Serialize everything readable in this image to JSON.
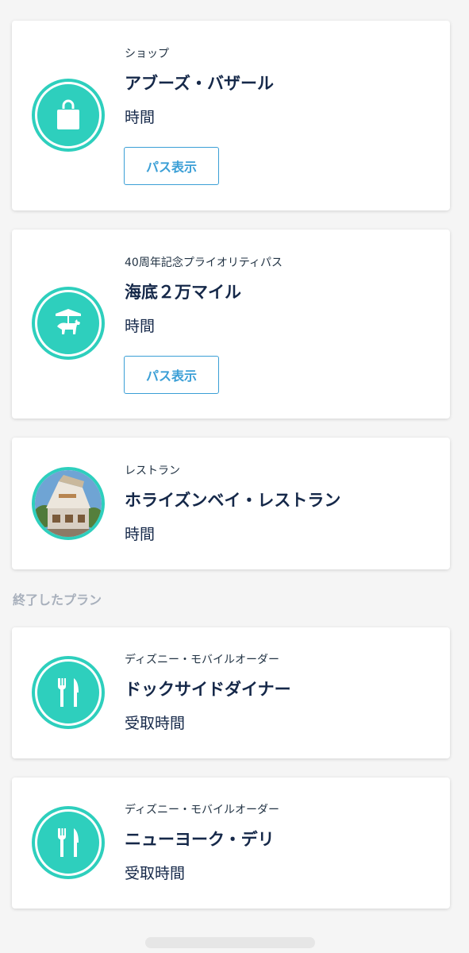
{
  "plans": [
    {
      "category": "ショップ",
      "name": "アブーズ・バザール",
      "time_label": "時間",
      "button_label": "パス表示",
      "icon": "shopping-bag-icon"
    },
    {
      "category": "40周年記念プライオリティパス",
      "name": "海底２万マイル",
      "time_label": "時間",
      "button_label": "パス表示",
      "icon": "carousel-horse-icon"
    },
    {
      "category": "レストラン",
      "name": "ホライズンベイ・レストラン",
      "time_label": "時間",
      "icon": "restaurant-photo"
    }
  ],
  "completed_section": {
    "label": "終了したプラン",
    "items": [
      {
        "category": "ディズニー・モバイルオーダー",
        "name": "ドックサイドダイナー",
        "time_label": "受取時間",
        "icon": "fork-knife-icon"
      },
      {
        "category": "ディズニー・モバイルオーダー",
        "name": "ニューヨーク・デリ",
        "time_label": "受取時間",
        "icon": "fork-knife-icon"
      }
    ]
  },
  "colors": {
    "accent_teal": "#2ecfbd",
    "button_blue": "#3b9fd6",
    "title_navy": "#152849",
    "section_gray": "#a8b0bc"
  }
}
